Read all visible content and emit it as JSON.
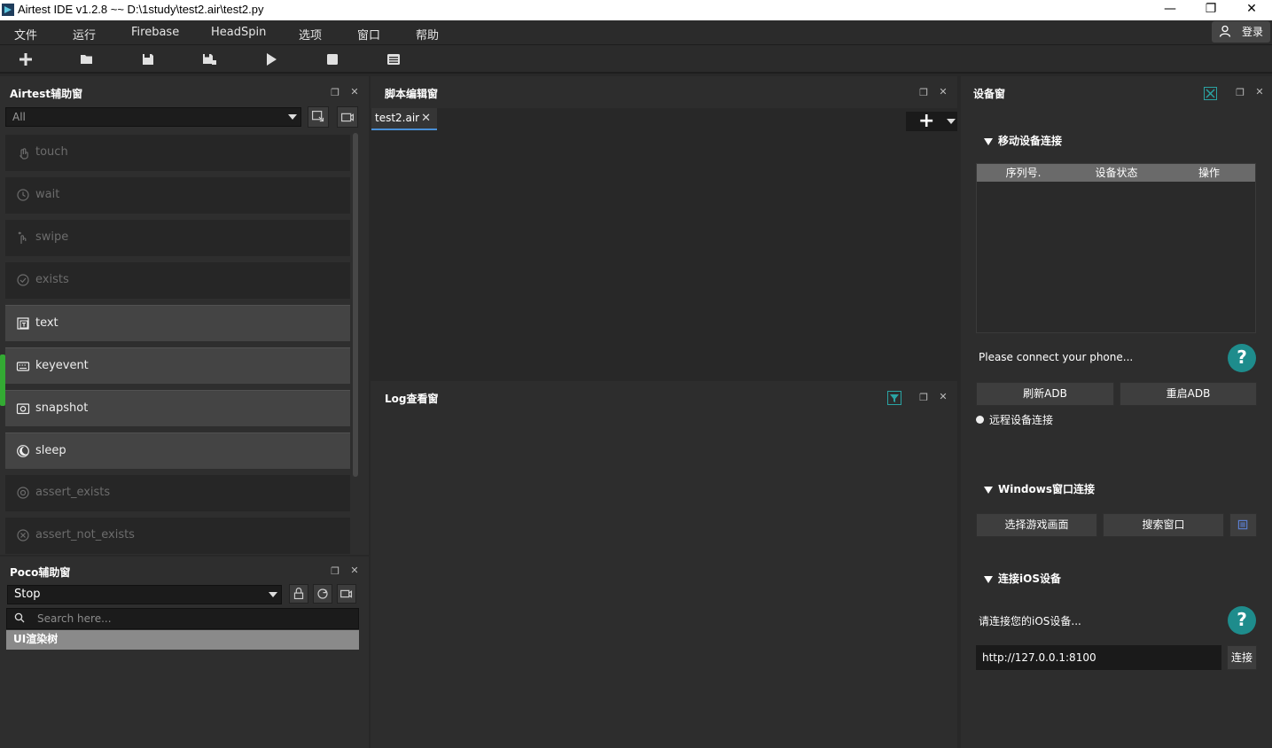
{
  "window": {
    "title": "Airtest IDE v1.2.8 ~~ D:\\1study\\test2.air\\test2.py",
    "minimize": "—",
    "maximize": "❐",
    "close": "✕"
  },
  "menu": {
    "items": [
      "文件",
      "运行",
      "Firebase",
      "HeadSpin",
      "选项",
      "窗口",
      "帮助"
    ],
    "login_label": "登录"
  },
  "toolbar": {
    "icons": [
      "new-file-icon",
      "open-folder-icon",
      "save-icon",
      "save-as-icon",
      "run-icon",
      "stop-icon",
      "log-list-icon"
    ]
  },
  "airtest_panel": {
    "title": "Airtest辅助窗",
    "filter_value": "All",
    "actions": [
      {
        "label": "touch",
        "enabled": false,
        "icon": "hand-icon"
      },
      {
        "label": "wait",
        "enabled": false,
        "icon": "clock-icon"
      },
      {
        "label": "swipe",
        "enabled": false,
        "icon": "swipe-icon"
      },
      {
        "label": "exists",
        "enabled": false,
        "icon": "check-circle-icon"
      },
      {
        "label": "text",
        "enabled": true,
        "icon": "text-icon"
      },
      {
        "label": "keyevent",
        "enabled": true,
        "icon": "keyboard-icon"
      },
      {
        "label": "snapshot",
        "enabled": true,
        "icon": "camera-icon"
      },
      {
        "label": "sleep",
        "enabled": true,
        "icon": "moon-icon"
      },
      {
        "label": "assert_exists",
        "enabled": false,
        "icon": "target-icon"
      },
      {
        "label": "assert_not_exists",
        "enabled": false,
        "icon": "x-circle-icon"
      }
    ]
  },
  "poco_panel": {
    "title": "Poco辅助窗",
    "mode_value": "Stop",
    "search_placeholder": "Search here...",
    "tree_root": "UI渲染树"
  },
  "script_panel": {
    "title": "脚本编辑窗",
    "tabs": [
      {
        "label": "test2.air",
        "close": "✕"
      }
    ],
    "add_tab": "+"
  },
  "log_panel": {
    "title": "Log查看窗"
  },
  "device_panel": {
    "title": "设备窗",
    "mobile_section": {
      "title": "移动设备连接",
      "columns": [
        "序列号.",
        "设备状态",
        "操作"
      ],
      "status_text": "Please connect your phone...",
      "refresh_adb": "刷新ADB",
      "restart_adb": "重启ADB",
      "remote_label": "远程设备连接"
    },
    "windows_section": {
      "title": "Windows窗口连接",
      "select_game": "选择游戏画面",
      "search_window": "搜索窗口"
    },
    "ios_section": {
      "title": "连接iOS设备",
      "status_text": "请连接您的iOS设备...",
      "url_value": "http://127.0.0.1:8100",
      "connect_label": "连接"
    },
    "help_glyph": "?"
  },
  "colors": {
    "accent_teal": "#1e8c8c",
    "tab_underline": "#4a8fd6",
    "panel_bg": "#2d2d2d"
  }
}
